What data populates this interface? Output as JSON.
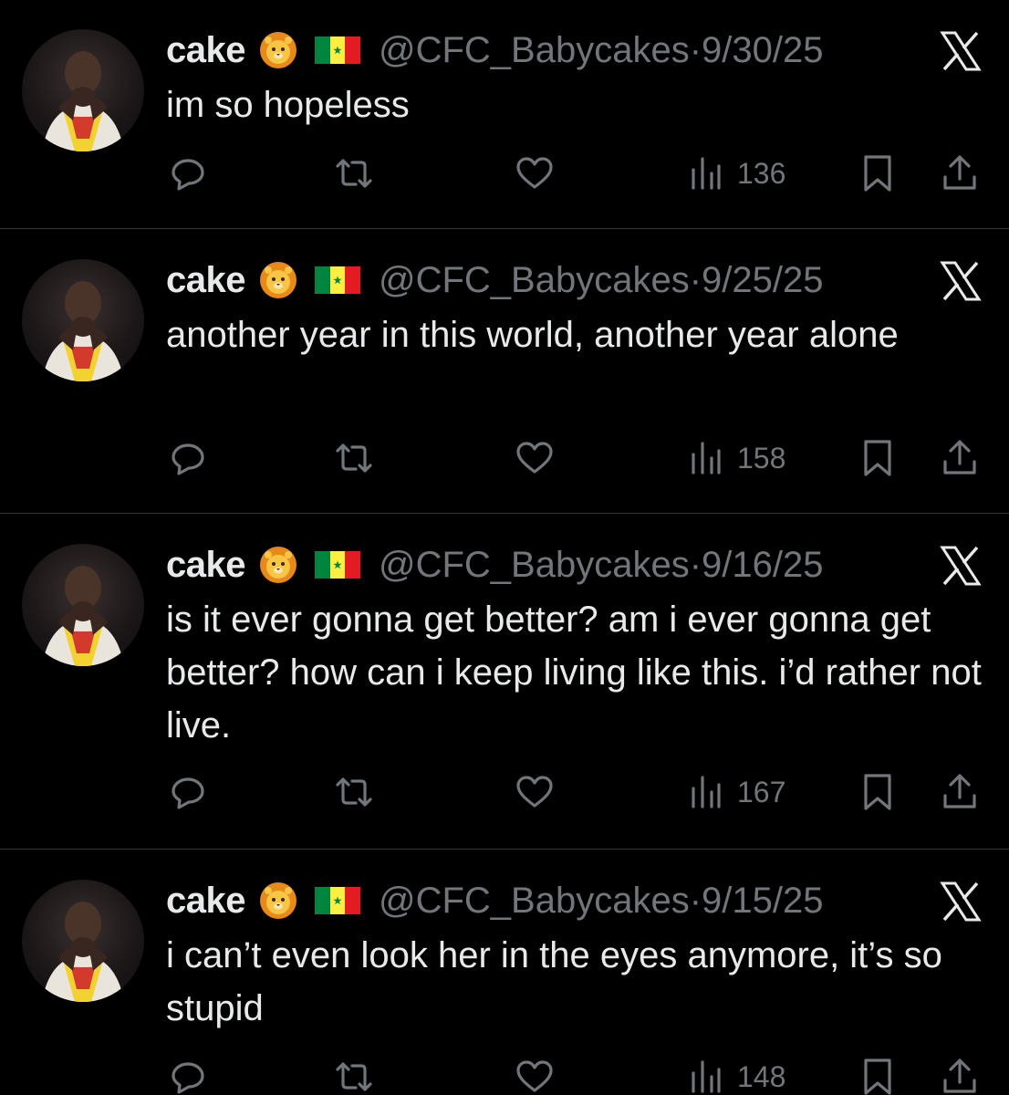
{
  "posts": [
    {
      "name": "cake",
      "emoji_icon": "lion-face-icon",
      "flag": "senegal-flag",
      "handle": "@CFC_Babycakes",
      "date": "9/30/25",
      "text": "im so hopeless",
      "views": "136"
    },
    {
      "name": "cake",
      "emoji_icon": "lion-face-icon",
      "flag": "senegal-flag",
      "handle": "@CFC_Babycakes",
      "date": "9/25/25",
      "text": "another year in this world, another year alone",
      "views": "158"
    },
    {
      "name": "cake",
      "emoji_icon": "lion-face-icon",
      "flag": "senegal-flag",
      "handle": "@CFC_Babycakes",
      "date": "9/16/25",
      "text": "is it ever gonna get better? am i ever gonna get better? how can i keep living like this. i’d rather not live.",
      "views": "167"
    },
    {
      "name": "cake",
      "emoji_icon": "lion-face-icon",
      "flag": "senegal-flag",
      "handle": "@CFC_Babycakes",
      "date": "9/15/25",
      "text": "i can’t even look her in the eyes anymore, it’s so stupid",
      "views": "148"
    }
  ],
  "separator": "·",
  "colors": {
    "background": "#000000",
    "text": "#e7e9ea",
    "muted": "#71767b",
    "divider": "#2f3336",
    "flag_green": "#00853f",
    "flag_yellow": "#fdef42",
    "flag_red": "#e31b23"
  }
}
